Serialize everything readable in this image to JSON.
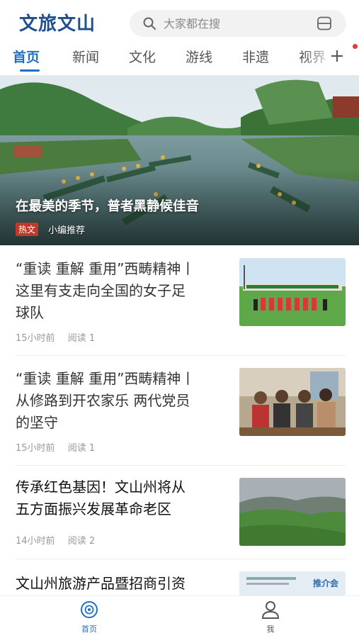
{
  "app": {
    "logo_text": "文旅文山"
  },
  "search": {
    "placeholder": "大家都在搜"
  },
  "tabs": [
    {
      "label": "首页",
      "active": true
    },
    {
      "label": "新闻",
      "active": false
    },
    {
      "label": "文化",
      "active": false
    },
    {
      "label": "游线",
      "active": false
    },
    {
      "label": "非遗",
      "active": false
    },
    {
      "label": "视界",
      "active": false
    }
  ],
  "hero": {
    "title": "在最美的季节，普者黑静候佳音",
    "badge": "热文",
    "tag": "小编推荐"
  },
  "articles": [
    {
      "title_lines": [
        "“重读 重解 重用”西畴精神丨",
        "这里有支走向全国的女子足",
        "球队"
      ],
      "time": "15小时前",
      "reads": "阅读 1"
    },
    {
      "title_lines": [
        "“重读 重解 重用”西畴精神丨",
        "从修路到开农家乐 两代党员",
        "的坚守"
      ],
      "time": "15小时前",
      "reads": "阅读 1"
    },
    {
      "title_lines": [
        "传承红色基因！文山州将从",
        "五方面振兴发展革命老区"
      ],
      "time": "14小时前",
      "reads": "阅读 2"
    },
    {
      "title_lines": [
        "文山州旅游产品暨招商引资"
      ],
      "time": "",
      "reads": ""
    }
  ],
  "thumb4_text": "推介会",
  "bottom_nav": {
    "home_label": "首页",
    "me_label": "我"
  },
  "colors": {
    "accent": "#1f6fc4",
    "badge": "#c0392b",
    "notify_dot": "#e53935"
  }
}
